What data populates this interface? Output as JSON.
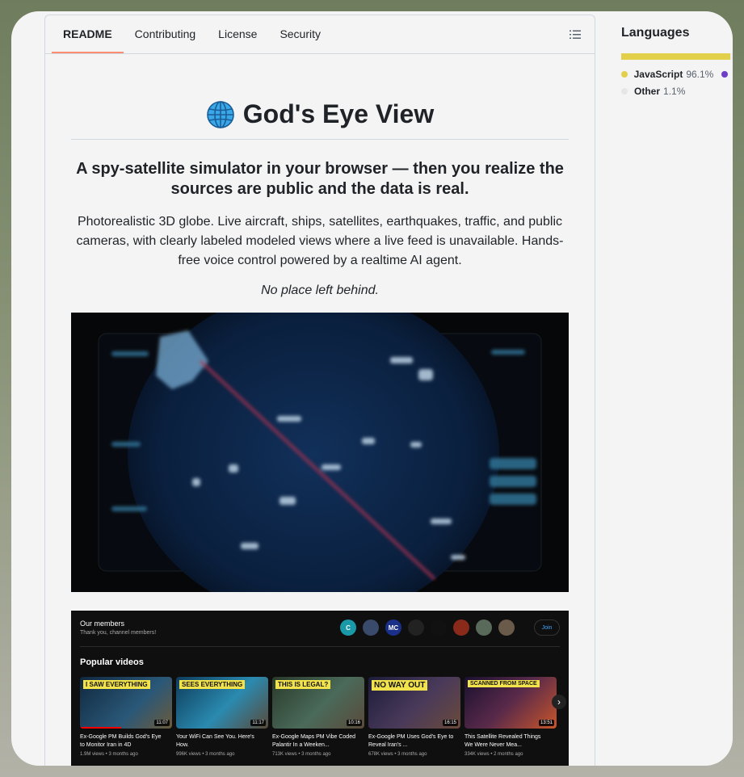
{
  "tabs": [
    {
      "label": "README"
    },
    {
      "label": "Contributing"
    },
    {
      "label": "License"
    },
    {
      "label": "Security"
    }
  ],
  "readme": {
    "title": "God's Eye View",
    "subtitle": "A spy-satellite simulator in your browser — then you realize the sources are public and the data is real.",
    "description": "Photorealistic 3D globe. Live aircraft, ships, satellites, earthquakes, traffic, and public cameras, with clearly labeled modeled views where a live feed is unavailable. Hands-free voice control powered by a realtime AI agent.",
    "tagline": "No place left behind."
  },
  "languages": {
    "title": "Languages",
    "items": [
      {
        "name": "JavaScript",
        "percent": "96.1%",
        "color": "#e3d04a"
      },
      {
        "name": "Other",
        "percent": "1.1%",
        "color": "#ededed"
      }
    ],
    "extra_dot_color": "#6e40c9"
  },
  "youtube": {
    "members_title": "Our members",
    "members_subtitle": "Thank you, channel members!",
    "join_label": "Join",
    "popular_title": "Popular videos",
    "avatars": [
      {
        "text": "C",
        "color": "#1a9aa8"
      },
      {
        "text": "",
        "color": "#3a4a6a"
      },
      {
        "text": "MC",
        "color": "#1a2f8a"
      },
      {
        "text": "",
        "color": "#222222"
      },
      {
        "text": "",
        "color": "#111111"
      },
      {
        "text": "",
        "color": "#8a2a1a"
      },
      {
        "text": "",
        "color": "#5a6a5a"
      },
      {
        "text": "",
        "color": "#6a5a4a"
      }
    ],
    "videos": [
      {
        "banner": "I SAW EVERYTHING",
        "banner_color": "#f2e24b",
        "thumb_color": "#1a3a5a",
        "duration": "11:07",
        "title": "Ex-Google PM Builds God's Eye to Monitor Iran in 4D",
        "meta": "1.9M views • 3 months ago",
        "progress": 0.45
      },
      {
        "banner": "SEES EVERYTHING",
        "banner_color": "#f2e24b",
        "thumb_color": "#1a5a7a",
        "duration": "11:17",
        "title": "Your WiFi Can See You. Here's How.",
        "meta": "996K views • 3 months ago",
        "progress": 0.0
      },
      {
        "banner": "THIS IS LEGAL?",
        "banner_color": "#f2e24b",
        "thumb_color": "#3a4a3a",
        "duration": "10:16",
        "title": "Ex-Google Maps PM Vibe Coded Palantir In a Weeken...",
        "meta": "713K views • 3 months ago",
        "progress": 0.0
      },
      {
        "banner": "NO WAY OUT",
        "banner_color": "#f2e24b",
        "thumb_color": "#2a2a4a",
        "duration": "16:15",
        "title": "Ex-Google PM Uses God's Eye to Reveal Iran's ...",
        "meta": "678K views • 3 months ago",
        "progress": 0.0
      },
      {
        "banner": "SCANNED FROM SPACE",
        "banner_color": "#f2e24b",
        "thumb_color": "#2a1a3a",
        "duration": "13:51",
        "title": "This Satellite Revealed Things We Were Never Mea...",
        "meta": "334K views • 2 months ago",
        "progress": 0.0
      }
    ]
  }
}
